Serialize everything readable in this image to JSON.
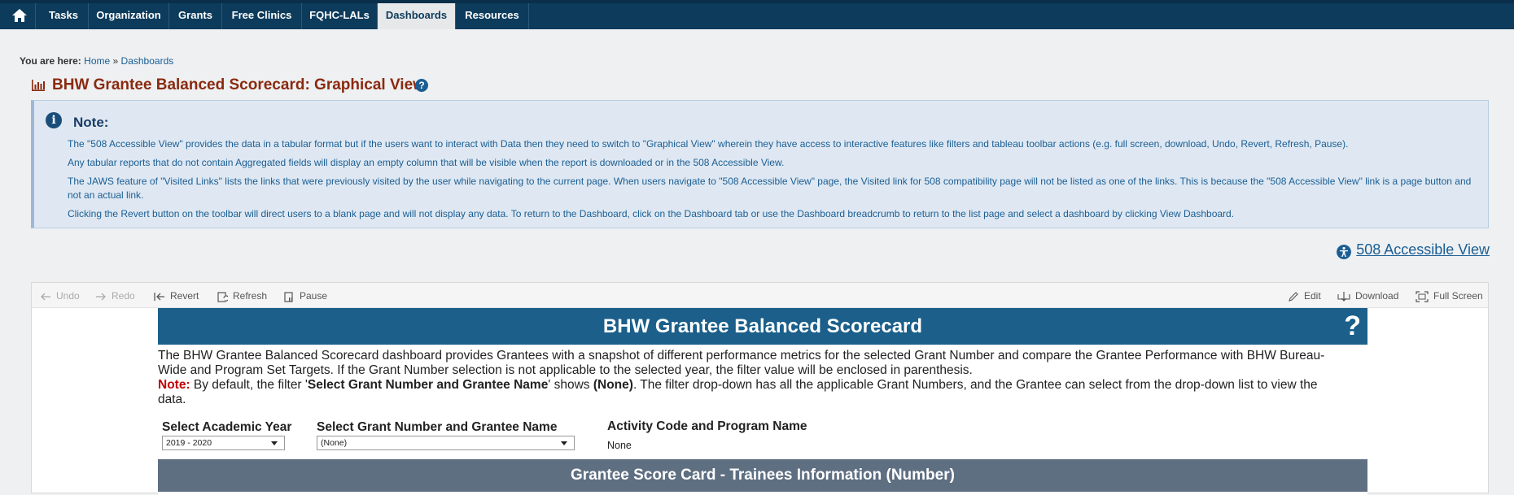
{
  "nav": {
    "items": [
      "Tasks",
      "Organization",
      "Grants",
      "Free Clinics",
      "FQHC-LALs",
      "Dashboards",
      "Resources"
    ],
    "active": "Dashboards"
  },
  "breadcrumb": {
    "label": "You are here:",
    "home": "Home",
    "sep": "»",
    "current": "Dashboards"
  },
  "page": {
    "title": "BHW Grantee Balanced Scorecard: Graphical View",
    "help_icon": "question-circle-icon"
  },
  "note": {
    "title": "Note:",
    "lines": [
      "The \"508 Accessible View\" provides the data in a tabular format but if the users want to interact with Data then they need to switch to \"Graphical View\" wherein they have access to interactive features like filters and tableau toolbar actions (e.g. full screen, download, Undo, Revert, Refresh, Pause).",
      "Any tabular reports that do not contain Aggregated fields will display an empty column that will be visible when the report is downloaded or in the 508 Accessible View.",
      "The JAWS feature of \"Visited Links\" lists the links that were previously visited by the user while navigating to the current page. When users navigate to \"508 Accessible View\" page, the Visited link for 508 compatibility page will not be listed as one of the links. This is because the \"508 Accessible View\" link is a page button and",
      "not an actual link.",
      "Clicking the Revert button on the toolbar will direct users to a blank page and will not display any data. To return to the Dashboard, click on the Dashboard tab or use the Dashboard breadcrumb to return to the list page and select a dashboard by clicking View Dashboard."
    ]
  },
  "access_link": "508 Accessible View",
  "toolbar": {
    "undo": "Undo",
    "redo": "Redo",
    "revert": "Revert",
    "refresh": "Refresh",
    "pause": "Pause",
    "edit": "Edit",
    "download": "Download",
    "fullscreen": "Full Screen"
  },
  "dashboard": {
    "title": "BHW Grantee Balanced Scorecard",
    "help": "?",
    "desc1": "The BHW Grantee Balanced Scorecard dashboard provides Grantees with a snapshot of different performance metrics for the selected Grant Number and compare the Grantee Performance with BHW Bureau-",
    "desc2": "Wide and Program Set Targets. If the Grant Number selection is not applicable to the selected year, the filter value will be enclosed in parenthesis.",
    "note_label": "Note:",
    "note_a": " By default, the filter '",
    "note_b": "Select Grant Number and Grantee Name",
    "note_c": "' shows ",
    "note_d": "(None)",
    "note_e": ". The filter drop-down has all the applicable Grant Numbers, and the Grantee can select from the drop-down list to view the",
    "note_f": "data.",
    "filter_year_label": "Select Academic Year",
    "filter_year_value": "2019 - 2020",
    "filter_grant_label": "Select Grant Number and Grantee Name",
    "filter_grant_value": "(None)",
    "activity_label": "Activity Code and Program Name",
    "activity_value": "None",
    "section_title": "Grantee Score Card - Trainees Information (Number)"
  }
}
